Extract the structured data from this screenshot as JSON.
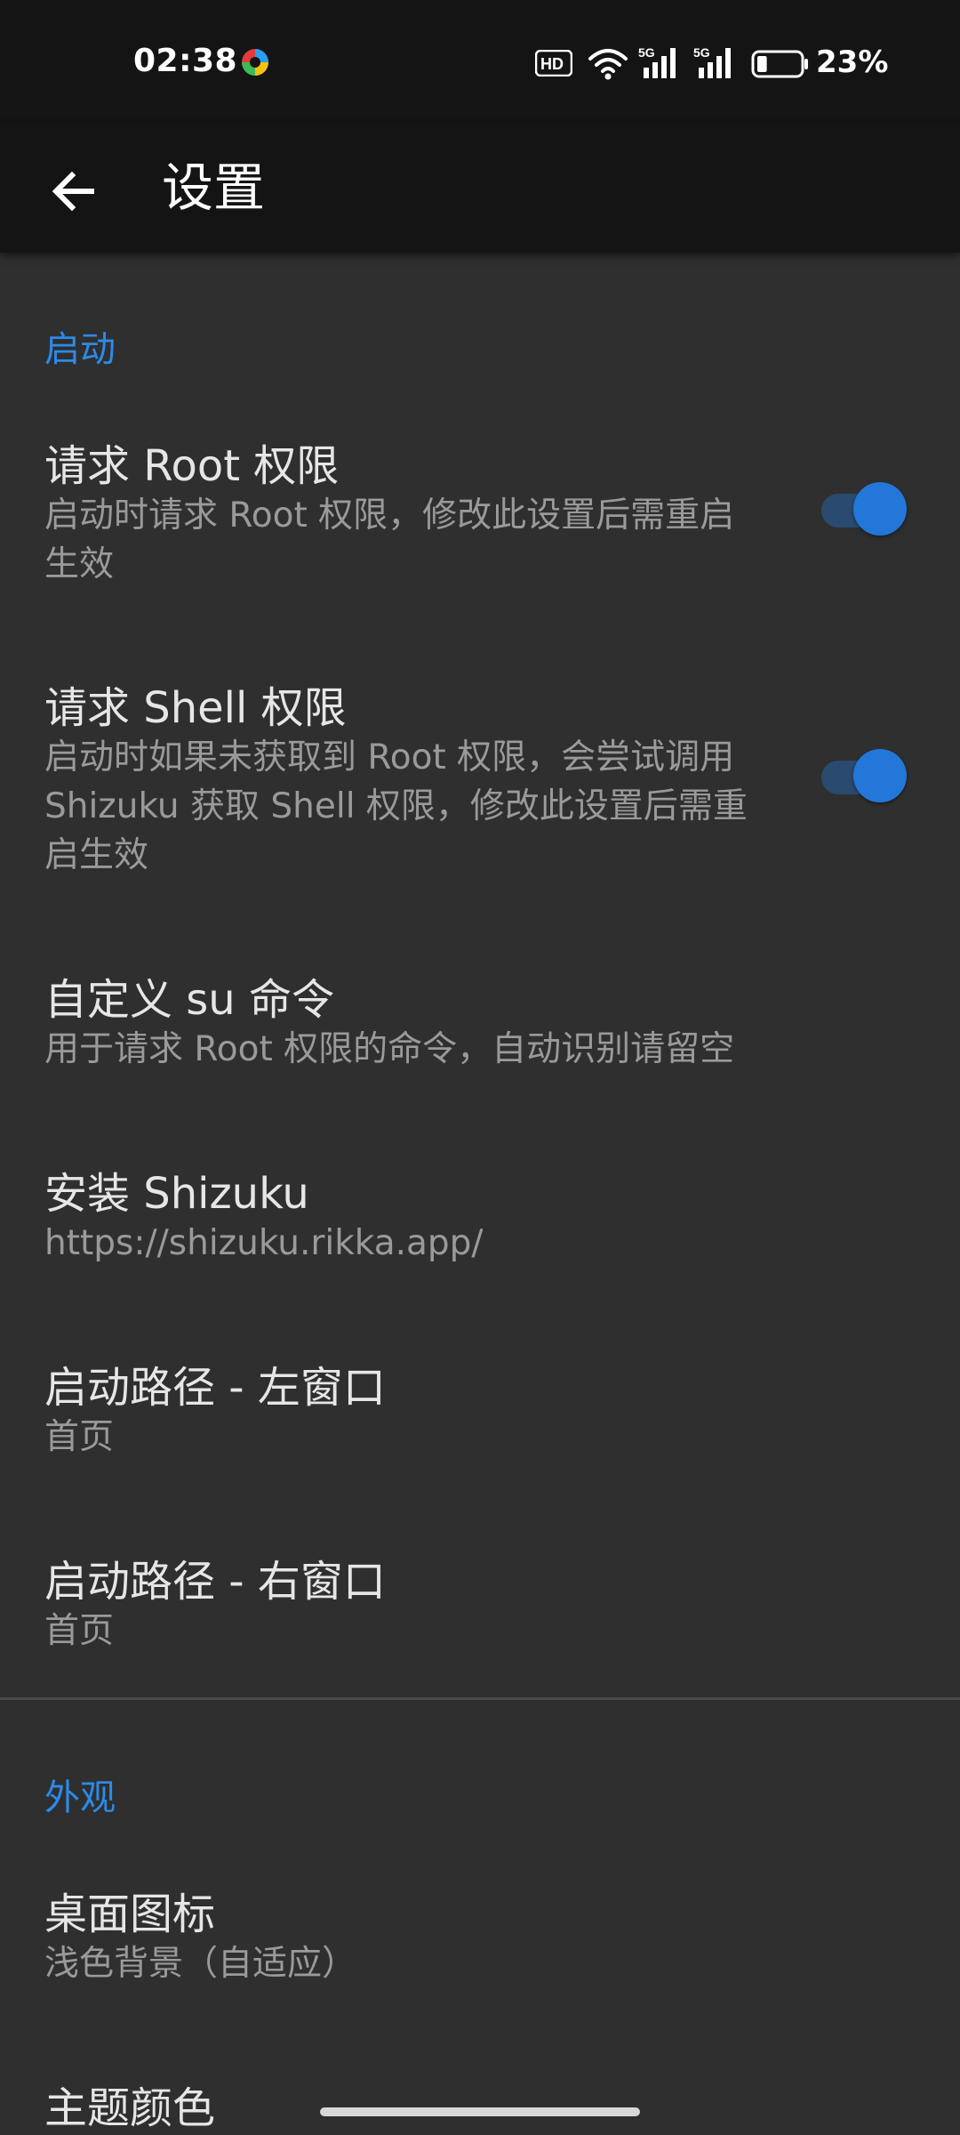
{
  "status_bar": {
    "time": "02:38",
    "battery_percent": "23%",
    "battery_level": 0.23,
    "icons": [
      "app-notification-icon",
      "hd-voice-icon",
      "wifi-icon",
      "5g-signal-icon",
      "5g-signal-icon",
      "battery-icon"
    ],
    "signal_label": "5G",
    "hd_label": "HD"
  },
  "app_bar": {
    "title": "设置",
    "back_icon": "arrow-left-icon"
  },
  "sections": {
    "startup": {
      "header": "启动",
      "request_root": {
        "title": "请求 Root 权限",
        "summary": "启动时请求 Root 权限，修改此设置后需重启生效",
        "enabled": true
      },
      "request_shell": {
        "title": "请求 Shell 权限",
        "summary": "启动时如果未获取到 Root 权限，会尝试调用 Shizuku 获取 Shell 权限，修改此设置后需重启生效",
        "enabled": true
      },
      "custom_su": {
        "title": "自定义 su 命令",
        "summary": "用于请求 Root 权限的命令，自动识别请留空"
      },
      "install_shizuku": {
        "title": "安装 Shizuku",
        "summary": "https://shizuku.rikka.app/"
      },
      "start_path_left": {
        "title": "启动路径 - 左窗口",
        "summary": "首页"
      },
      "start_path_right": {
        "title": "启动路径 - 右窗口",
        "summary": "首页"
      }
    },
    "appearance": {
      "header": "外观",
      "desktop_icon": {
        "title": "桌面图标",
        "summary": "浅色背景（自适应）"
      },
      "theme_color": {
        "title": "主题颜色"
      }
    }
  },
  "colors": {
    "accent": "#2d8ae8",
    "background": "#2f2f2f",
    "bar": "#141414"
  }
}
